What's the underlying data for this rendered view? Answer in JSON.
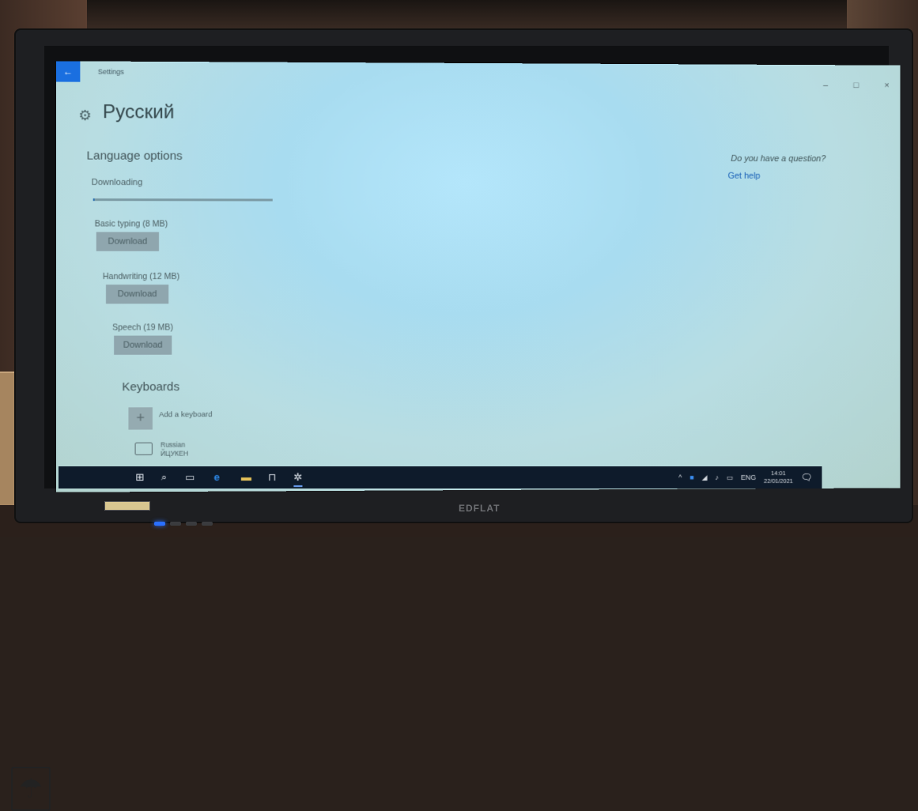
{
  "window": {
    "back_glyph": "←",
    "title": "Settings",
    "minimize_glyph": "–",
    "maximize_glyph": "□",
    "close_glyph": "×"
  },
  "page": {
    "icon": "gear-icon",
    "title": "Русский"
  },
  "language_options": {
    "heading": "Language options",
    "status": "Downloading",
    "progress_fraction": 0.01,
    "items": [
      {
        "label": "Basic typing (8 MB)",
        "button": "Download"
      },
      {
        "label": "Handwriting (12 MB)",
        "button": "Download"
      },
      {
        "label": "Speech (19 MB)",
        "button": "Download"
      }
    ]
  },
  "keyboards": {
    "heading": "Keyboards",
    "add_label": "Add a keyboard",
    "add_glyph": "+",
    "installed": [
      {
        "name": "Russian",
        "layout": "ЙЦУКЕН"
      }
    ]
  },
  "help": {
    "question": "Do you have a question?",
    "link": "Get help"
  },
  "taskbar": {
    "icons": [
      "windows-start-icon",
      "search-icon",
      "task-view-icon",
      "edge-icon",
      "file-explorer-icon",
      "store-icon",
      "settings-icon"
    ],
    "tray": {
      "chevron": "^",
      "lang": "ENG",
      "time": "14:01",
      "date": "22/01/2021"
    }
  },
  "monitor": {
    "brand": "EDFLAT"
  },
  "colors": {
    "accent": "#1a6fe0",
    "link": "#1b62b8",
    "taskbar": "#0e1b2b"
  }
}
